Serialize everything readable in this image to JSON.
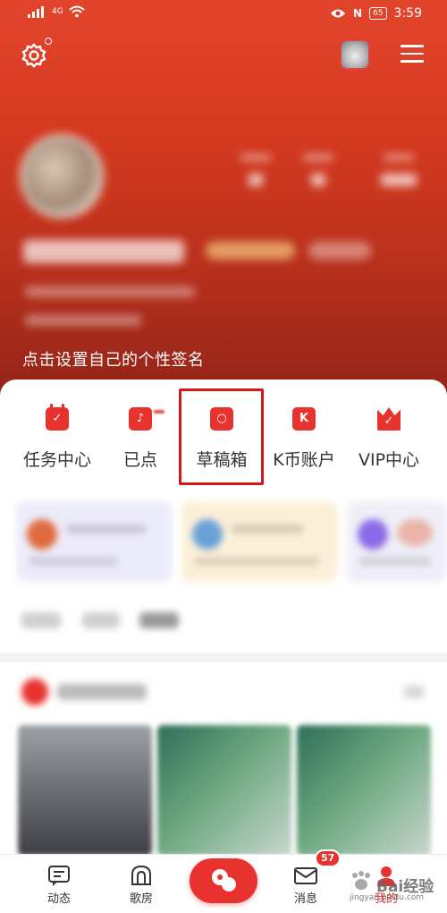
{
  "status_bar": {
    "network": "4G",
    "nfc": "N",
    "battery": "65",
    "time": "3:59"
  },
  "header": {
    "settings_icon": "gear-icon",
    "menu_icon": "hamburger-icon",
    "signature": "点击设置自己的个性签名"
  },
  "quick_menu": [
    {
      "label": "任务中心",
      "icon": "calendar-check-icon",
      "glyph": "✓"
    },
    {
      "label": "已点",
      "icon": "music-note-icon",
      "glyph": "♪"
    },
    {
      "label": "草稿箱",
      "icon": "draft-box-icon",
      "glyph": "○"
    },
    {
      "label": "K币账户",
      "icon": "k-coin-wallet-icon",
      "glyph": "K"
    },
    {
      "label": "VIP中心",
      "icon": "vip-crown-icon",
      "glyph": "✓"
    }
  ],
  "bottom_nav": [
    {
      "label": "动态",
      "icon": "feed-icon"
    },
    {
      "label": "歌房",
      "icon": "room-icon"
    },
    {
      "label": "",
      "icon": "sing-icon"
    },
    {
      "label": "消息",
      "icon": "mail-icon",
      "badge": "57"
    },
    {
      "label": "我的",
      "icon": "profile-icon"
    }
  ],
  "watermark": {
    "text": "Bai经验",
    "url": "jingyan.baidu.com"
  },
  "colors": {
    "brand_red": "#e8322e",
    "highlight_box": "#d01a1a"
  }
}
